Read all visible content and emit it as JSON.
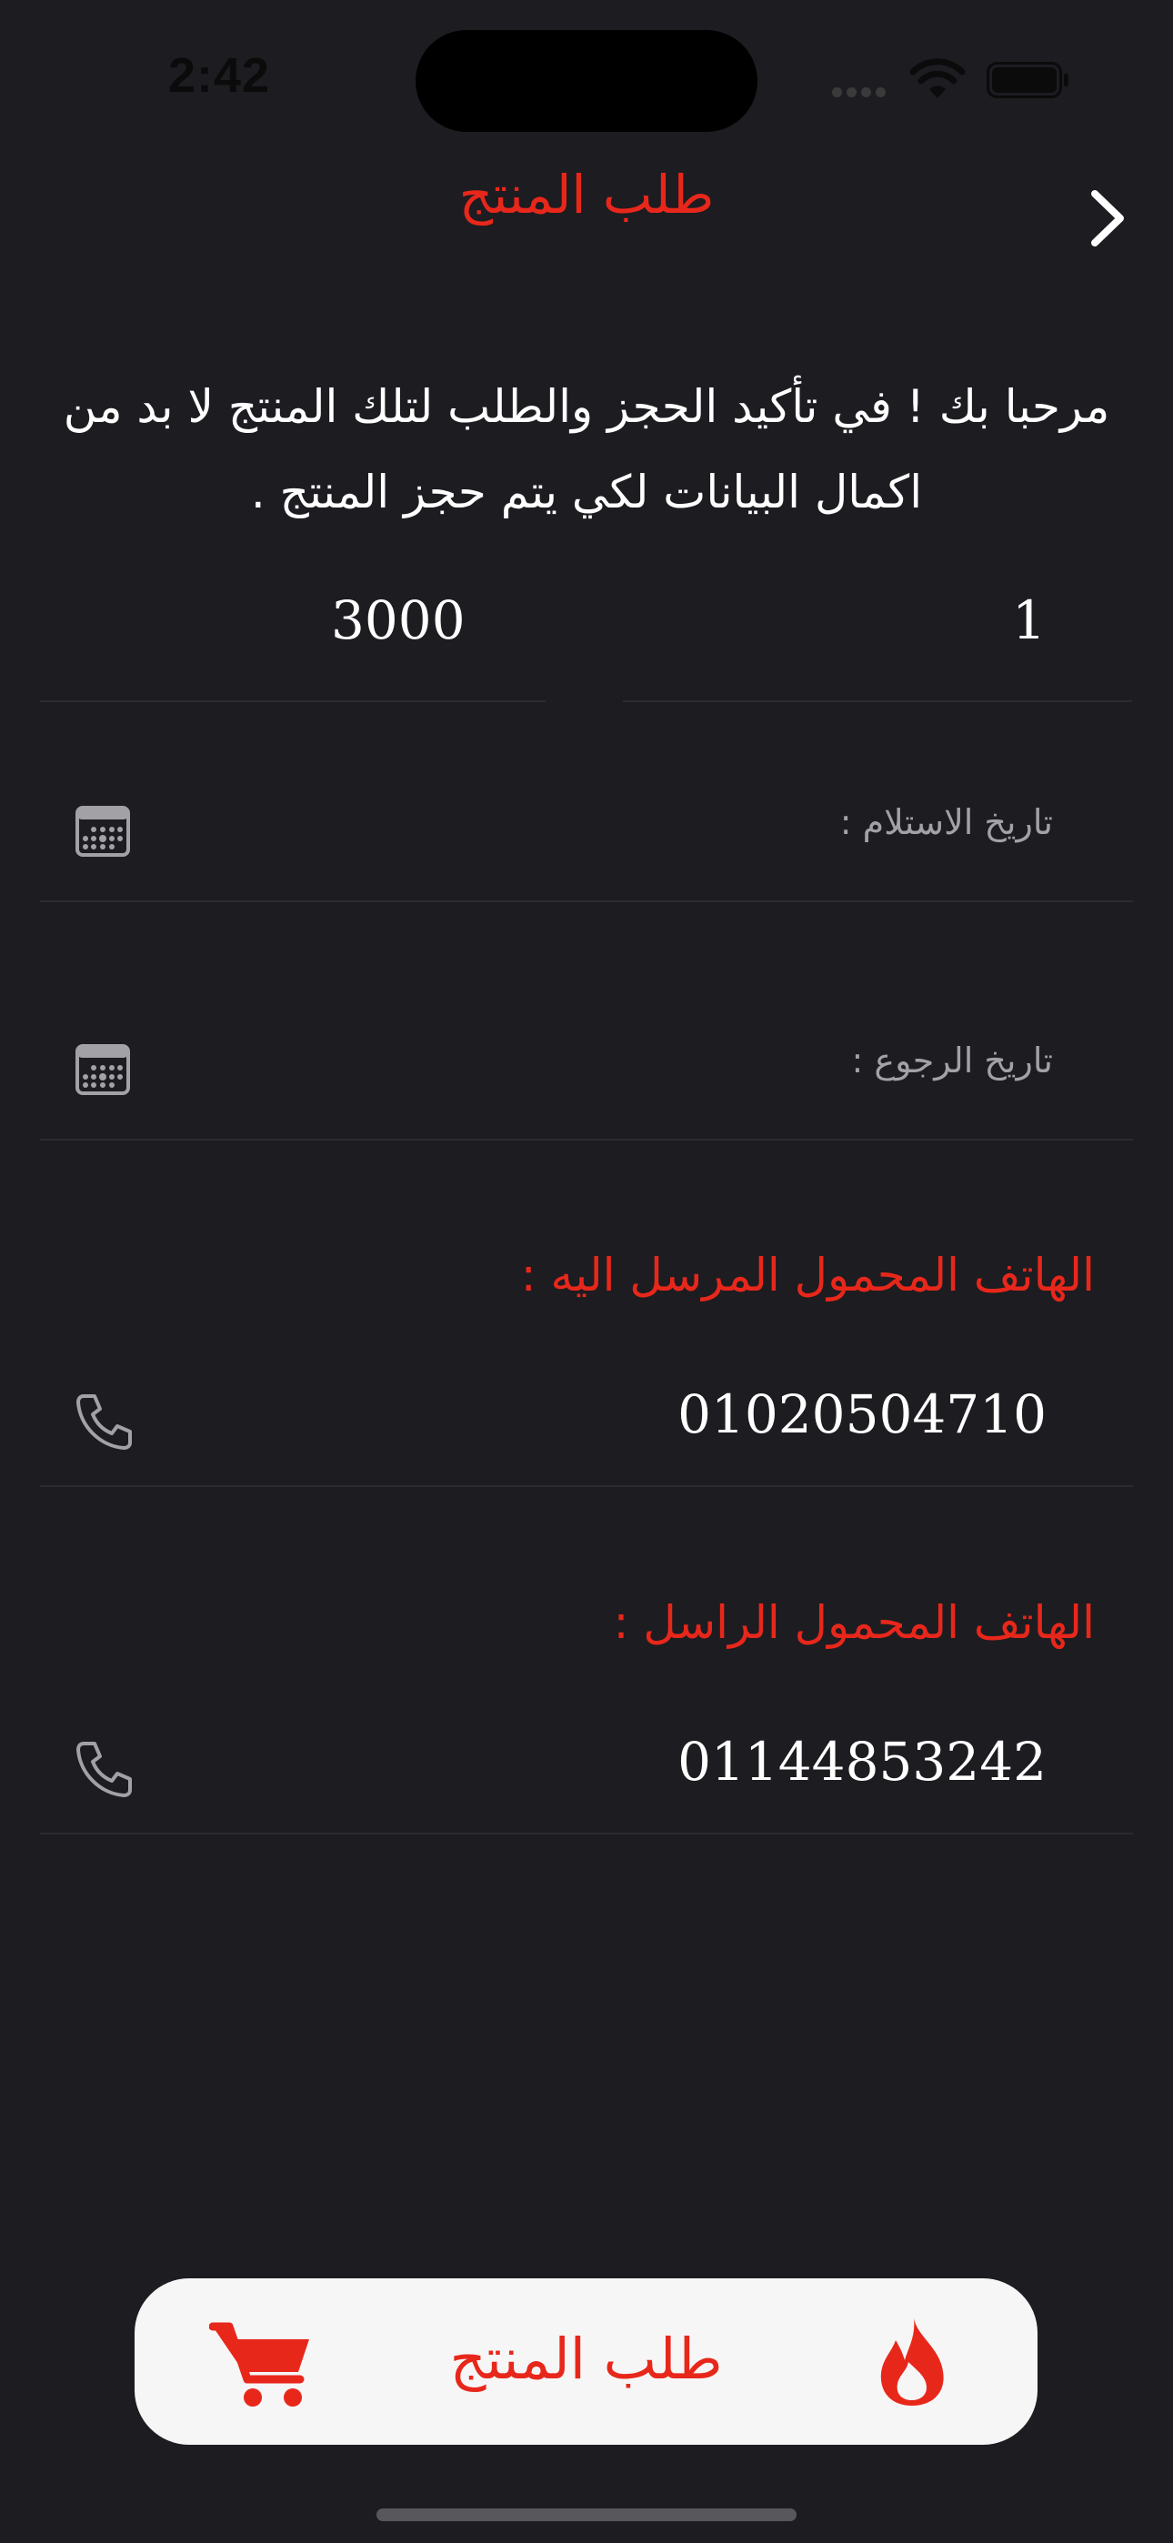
{
  "status_bar": {
    "time": "2:42"
  },
  "header": {
    "title": "طلب المنتج"
  },
  "intro_text": "مرحبا بك ! في تأكيد الحجز والطلب لتلك المنتج لا بد من اكمال البيانات لكي يتم حجز المنتج .",
  "summary": {
    "quantity": "1",
    "price": "3000"
  },
  "pickup_date": {
    "placeholder": "تاريخ الاستلام :"
  },
  "return_date": {
    "placeholder": "تاريخ الرجوع :"
  },
  "recipient_phone": {
    "label": "الهاتف المحمول المرسل اليه :",
    "value": "01020504710"
  },
  "sender_phone": {
    "label": "الهاتف المحمول الراسل :",
    "value": "01144853242"
  },
  "order_button": {
    "label": "طلب المنتج"
  },
  "icons": {
    "back": "chevron-right-icon",
    "calendar": "calendar-icon",
    "phone": "phone-icon",
    "cart": "cart-icon",
    "flame": "flame-icon"
  },
  "colors": {
    "background": "#1d1c21",
    "accent": "#e8271b",
    "button_background": "#f7f6f6",
    "muted_text": "#a2a2a6"
  }
}
